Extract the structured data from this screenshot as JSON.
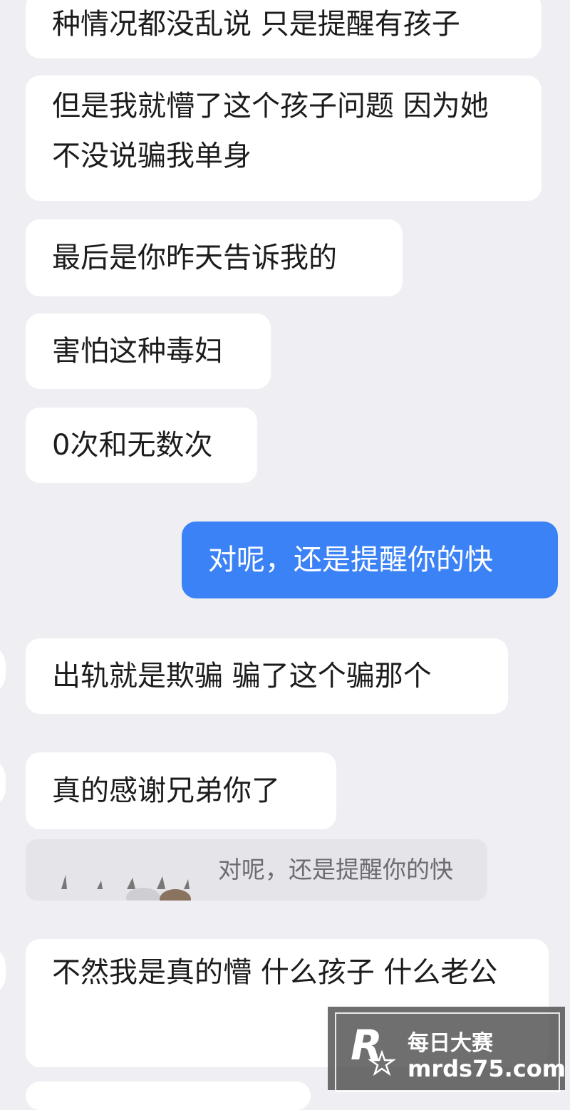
{
  "messages": [
    {
      "side": "left",
      "text": "种情况都没乱说 只是提醒有孩子"
    },
    {
      "side": "left",
      "text": "但是我就懵了这个孩子问题 因为她不没说骗我单身"
    },
    {
      "side": "left",
      "text": "最后是你昨天告诉我的"
    },
    {
      "side": "left",
      "text": "害怕这种毒妇"
    },
    {
      "side": "left",
      "text": "0次和无数次"
    },
    {
      "side": "right",
      "text": "对呢，还是提醒你的快"
    },
    {
      "side": "left",
      "text": "出轨就是欺骗 骗了这个骗那个"
    },
    {
      "side": "left",
      "text": "真的感谢兄弟你了"
    },
    {
      "side": "left",
      "text": "不然我是真的懵 什么孩子 什么老公"
    }
  ],
  "quote": {
    "text": "对呢，还是提醒你的快"
  },
  "watermark": {
    "brand": "每日大赛",
    "url": "mrds75.com"
  },
  "colors": {
    "background": "#efeff3",
    "incoming_bubble": "#ffffff",
    "outgoing_bubble": "#3b82f6"
  }
}
